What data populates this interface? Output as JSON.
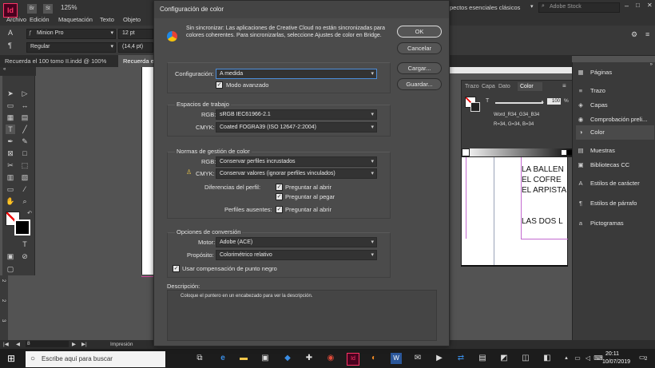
{
  "app": {
    "zoom": "125%",
    "menu": [
      "Archivo",
      "Edición",
      "Maquetación",
      "Texto",
      "Objeto"
    ],
    "workspace": "pectos esenciales clásicos",
    "stock_search": "Adobe Stock",
    "font_family": "Minion Pro",
    "font_style": "Regular",
    "font_size": "12 pt",
    "leading": "(14,4 pt)",
    "tab_1": "Recuerda el 100 tomo II.indd @ 100%",
    "tab_2": "Recuerda el"
  },
  "page": {
    "lines": [
      "LA BALLEN",
      "EL COFRE",
      "EL ARPISTA",
      "",
      "LAS DOS L"
    ]
  },
  "colorpanel": {
    "tabs": [
      "Trazo",
      "Capa",
      "Dato",
      "Color"
    ],
    "tint_value": "100",
    "tint_unit": "%",
    "swatch_name": "Word_R34_G34_B34",
    "swatch_values": "R=34, G=34, B=34"
  },
  "rpanel": {
    "items": [
      {
        "label": "Páginas",
        "icon": "pages-icon",
        "glyph": "▦"
      },
      {
        "label": "Trazo",
        "icon": "stroke-icon",
        "glyph": "≡"
      },
      {
        "label": "Capas",
        "icon": "layers-icon",
        "glyph": "◈"
      },
      {
        "label": "Comprobación preli...",
        "icon": "preflight-icon",
        "glyph": "◉"
      },
      {
        "label": "Color",
        "icon": "color-icon",
        "glyph": "◑"
      },
      {
        "label": "Muestras",
        "icon": "swatches-icon",
        "glyph": "▤"
      },
      {
        "label": "Bibliotecas CC",
        "icon": "libraries-icon",
        "glyph": "▣"
      },
      {
        "label": "Estilos de carácter",
        "icon": "char-styles-icon",
        "glyph": "A"
      },
      {
        "label": "Estilos de párrafo",
        "icon": "para-styles-icon",
        "glyph": "¶"
      },
      {
        "label": "Pictogramas",
        "icon": "glyphs-icon",
        "glyph": "a"
      }
    ]
  },
  "dialog": {
    "title": "Configuración de color",
    "sync_message": "Sin sincronizar: Las aplicaciones de Creative Cloud no están sincronizadas para colores coherentes. Para sincronizarlas, seleccione Ajustes de color en Bridge.",
    "settings_label": "Configuración:",
    "settings_value": "A medida",
    "advanced_mode": "Modo avanzado",
    "workspaces_title": "Espacios de trabajo",
    "rgb_label": "RGB:",
    "rgb_value": "sRGB IEC61966-2.1",
    "cmyk_label": "CMYK:",
    "cmyk_value": "Coated FOGRA39 (ISO 12647-2:2004)",
    "policies_title": "Normas de gestión de color",
    "policy_rgb_value": "Conservar perfiles incrustados",
    "policy_cmyk_value": "Conservar valores (ignorar perfiles vinculados)",
    "mismatch_label": "Diferencias del perfil:",
    "ask_open": "Preguntar al abrir",
    "ask_paste": "Preguntar al pegar",
    "missing_label": "Perfiles ausentes:",
    "ask_open_2": "Preguntar al abrir",
    "conversion_title": "Opciones de conversión",
    "engine_label": "Motor:",
    "engine_value": "Adobe (ACE)",
    "intent_label": "Propósito:",
    "intent_value": "Colorimétrico relativo",
    "blackpoint": "Usar compensación de punto negro",
    "description_label": "Descripción:",
    "description_text": "Coloque el puntero en un encabezado para ver la descripción.",
    "ok": "OK",
    "cancel": "Cancelar",
    "load": "Cargar...",
    "save": "Guardar..."
  },
  "status": {
    "page_num": "8",
    "mode": "Impresión"
  },
  "taskbar": {
    "search_placeholder": "Escribe aquí para buscar",
    "time": "20:11",
    "date": "10/07/2019",
    "notifications": "2"
  },
  "colors": {
    "dialog_bg": "#4b4b4b",
    "ui_dark": "#323232",
    "accent_blue": "#4d8edb",
    "indesign_pink": "#ff3366"
  }
}
